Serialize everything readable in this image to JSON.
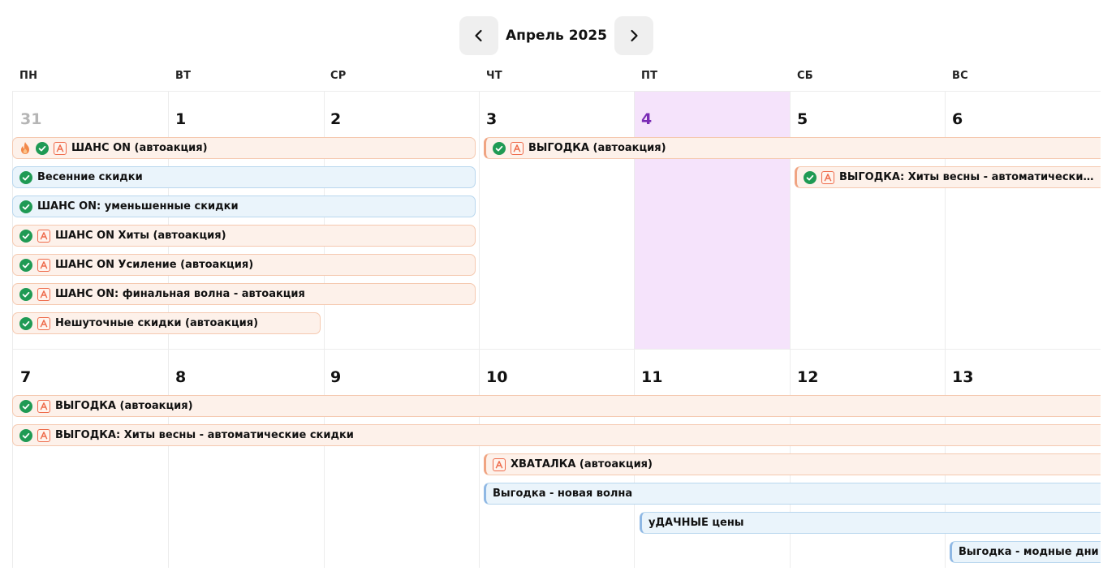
{
  "header": {
    "month_title": "Апрель 2025",
    "prev_icon": "chevron-left-icon",
    "next_icon": "chevron-right-icon"
  },
  "weekdays": [
    "ПН",
    "ВТ",
    "СР",
    "ЧТ",
    "ПТ",
    "СБ",
    "ВС"
  ],
  "weeks": [
    {
      "days": [
        "31",
        "1",
        "2",
        "3",
        "4",
        "5",
        "6"
      ]
    },
    {
      "days": [
        "7",
        "8",
        "9",
        "10",
        "11",
        "12",
        "13"
      ]
    }
  ],
  "today": "4",
  "colors": {
    "today_bg": "#f5e3fb",
    "today_text": "#7a2bb5",
    "check_green": "#1f9a54",
    "auto_orange": "#ee6a4a",
    "fire_orange": "#f2884a",
    "event_orange_bg": "#fdf1ea",
    "event_blue_bg": "#eaf4fb"
  },
  "events": {
    "w1": [
      "ШАНС ON (автоакция)",
      "ВЫГОДКА (автоакция)",
      "Весенние скидки",
      "ВЫГОДКА: Хиты весны - автоматические ск...",
      "ШАНС ON: уменьшенные скидки",
      "ШАНС ON Хиты (автоакция)",
      "ШАНС ON Усиление (автоакция)",
      "ШАНС ON: финальная волна - автоакция",
      "Нешуточные скидки (автоакция)"
    ],
    "w2": [
      "ВЫГОДКА (автоакция)",
      "ВЫГОДКА: Хиты весны - автоматические скидки",
      "ХВАТАЛКА (автоакция)",
      "Выгодка - новая волна",
      "уДАЧНЫЕ цены",
      "Выгодка - модные дни"
    ]
  }
}
